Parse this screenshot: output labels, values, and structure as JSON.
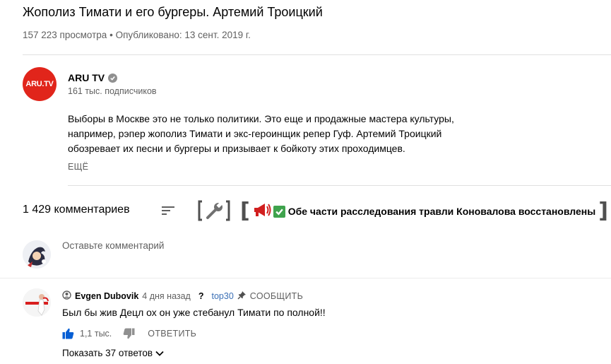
{
  "video": {
    "title": "Жополиз Тимати и его бургеры. Артемий Троицкий",
    "views": "157 223 просмотра",
    "bullet": "•",
    "published": "Опубликовано: 13 сент. 2019 г."
  },
  "channel": {
    "avatar_text": "ARU.TV",
    "name": "ARU TV",
    "subscribers": "161 тыс. подписчиков",
    "accent_color": "#e1251b"
  },
  "description": {
    "lines": [
      "Выборы в Москве это не только политики. Это еще и продажные мастера культуры,",
      "например, рэпер жополиз Тимати и экс-героинщик репер Гуф. Артемий Троицкий",
      "обозревает их песни и бургеры и призывает к бойкоту этих проходимцев."
    ],
    "more_label": "ЕЩЁ"
  },
  "comments": {
    "count": "1 429 комментариев",
    "promo": {
      "bracket_open": "[",
      "bracket_close": "]",
      "text": "Обе части расследования травли Коновалова восстановлены"
    },
    "add_placeholder": "Оставьте комментарий",
    "items": [
      {
        "author": "Evgen Dubovik",
        "time": "4 дня назад",
        "question": "?",
        "tag": "top30",
        "report": "СООБЩИТЬ",
        "text": "Был бы жив Децл ох он уже стебанул Тимати по полной!!",
        "likes": "1,1 тыс.",
        "reply_label": "ОТВЕТИТЬ",
        "show_replies": "Показать 37 ответов"
      }
    ]
  },
  "colors": {
    "secondary_text": "#606060",
    "like_blue": "#065fd4",
    "link_blue": "#3a6fb5",
    "check_green": "#3fa34d"
  }
}
